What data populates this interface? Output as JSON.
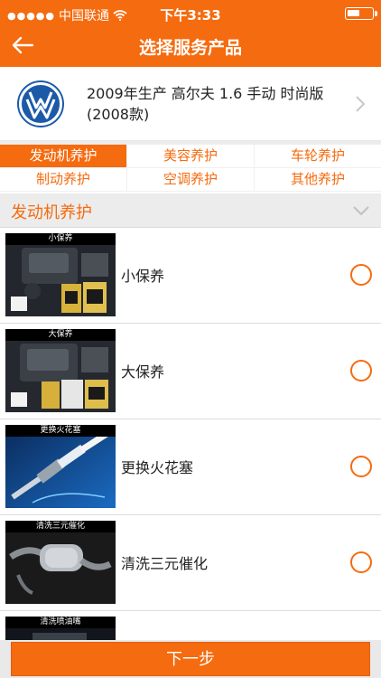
{
  "status_bar": {
    "carrier": "中国联通",
    "time": "下午3:33"
  },
  "header": {
    "title": "选择服务产品"
  },
  "car": {
    "description": "2009年生产 高尔夫 1.6 手动 时尚版(2008款)"
  },
  "tabs": [
    {
      "label": "发动机养护",
      "active": true
    },
    {
      "label": "美容养护",
      "active": false
    },
    {
      "label": "车轮养护",
      "active": false
    },
    {
      "label": "制动养护",
      "active": false
    },
    {
      "label": "空调养护",
      "active": false
    },
    {
      "label": "其他养护",
      "active": false
    }
  ],
  "section": {
    "title": "发动机养护"
  },
  "items": [
    {
      "name": "小保养",
      "thumb_label": "小保养",
      "selected": false
    },
    {
      "name": "大保养",
      "thumb_label": "大保养",
      "selected": false
    },
    {
      "name": "更换火花塞",
      "thumb_label": "更换火花塞",
      "selected": false
    },
    {
      "name": "清洗三元催化",
      "thumb_label": "清洗三元催化",
      "selected": false
    },
    {
      "name": "",
      "thumb_label": "清洗喷油嘴",
      "selected": false
    }
  ],
  "footer": {
    "next_label": "下一步"
  },
  "colors": {
    "accent": "#f56b0f",
    "background": "#ececec"
  }
}
